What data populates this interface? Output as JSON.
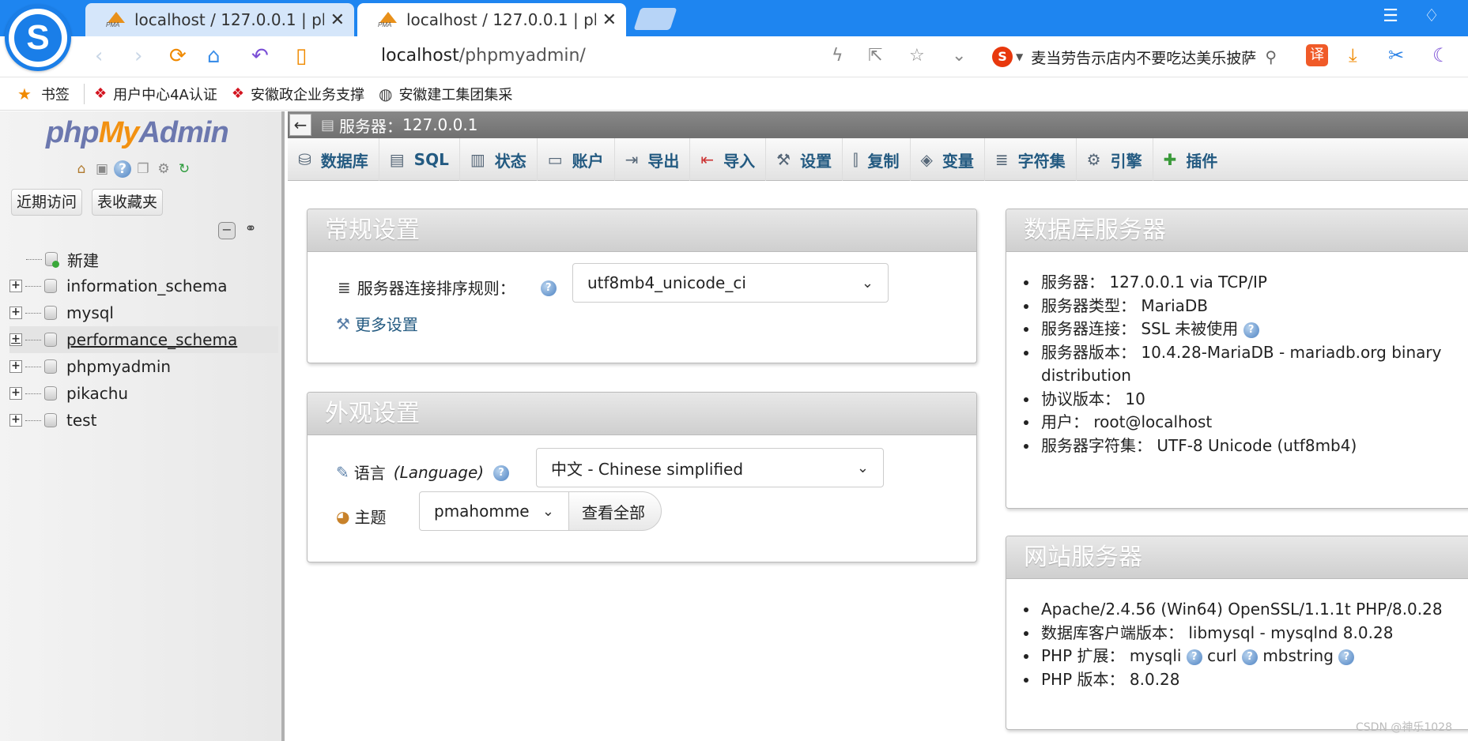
{
  "browser": {
    "tabs": [
      {
        "title": "localhost / 127.0.0.1 | phpMyAdmin",
        "close": "✕"
      },
      {
        "title": "localhost / 127.0.0.1 | phpMyAdmin",
        "close": "✕"
      }
    ],
    "url_host": "localhost",
    "url_path": "/phpmyadmin/",
    "search_text": "麦当劳告示店内不要吃达美乐披萨",
    "search_engine_letter": "S",
    "translate_label": "译",
    "bookmarks": [
      {
        "label": "书签",
        "icon": "star-icon"
      },
      {
        "label": "用户中心4A认证",
        "icon": "knot-icon"
      },
      {
        "label": "安徽政企业务支撑",
        "icon": "knot-icon"
      },
      {
        "label": "安徽建工集团集采",
        "icon": "globe-icon"
      }
    ]
  },
  "nav": {
    "logo": {
      "php": "php",
      "my": "My",
      "admin": "Admin"
    },
    "recent_btn": "近期访问",
    "favorites_btn": "表收藏夹",
    "new_label": "新建",
    "databases": [
      {
        "name": "information_schema"
      },
      {
        "name": "mysql"
      },
      {
        "name": "performance_schema"
      },
      {
        "name": "phpmyadmin"
      },
      {
        "name": "pikachu"
      },
      {
        "name": "test"
      }
    ]
  },
  "server_bar": {
    "label": "服务器：",
    "server": "127.0.0.1"
  },
  "menu": [
    {
      "label": "数据库",
      "icon": "database-icon"
    },
    {
      "label": "SQL",
      "icon": "sql-icon"
    },
    {
      "label": "状态",
      "icon": "status-icon"
    },
    {
      "label": "账户",
      "icon": "accounts-icon"
    },
    {
      "label": "导出",
      "icon": "export-icon"
    },
    {
      "label": "导入",
      "icon": "import-icon"
    },
    {
      "label": "设置",
      "icon": "settings-icon"
    },
    {
      "label": "复制",
      "icon": "replication-icon"
    },
    {
      "label": "变量",
      "icon": "variables-icon"
    },
    {
      "label": "字符集",
      "icon": "charset-icon"
    },
    {
      "label": "引擎",
      "icon": "engines-icon"
    },
    {
      "label": "插件",
      "icon": "plugins-icon"
    }
  ],
  "general": {
    "title": "常规设置",
    "collation_label": "服务器连接排序规则：",
    "collation_value": "utf8mb4_unicode_ci",
    "more_settings": "更多设置"
  },
  "appearance": {
    "title": "外观设置",
    "language_label": "语言",
    "language_label_en": "(Language)",
    "language_value": "中文 - Chinese simplified",
    "theme_label": "主题",
    "theme_value": "pmahomme",
    "view_all": "查看全部"
  },
  "db_server": {
    "title": "数据库服务器",
    "items": [
      {
        "label": "服务器：",
        "value": "127.0.0.1 via TCP/IP"
      },
      {
        "label": "服务器类型：",
        "value": "MariaDB"
      },
      {
        "label": "服务器连接：",
        "value": "SSL 未被使用"
      },
      {
        "label": "服务器版本：",
        "value": "10.4.28-MariaDB - mariadb.org binary distribution"
      },
      {
        "label": "协议版本：",
        "value": "10"
      },
      {
        "label": "用户：",
        "value": "root@localhost"
      },
      {
        "label": "服务器字符集：",
        "value": "UTF-8 Unicode (utf8mb4)"
      }
    ]
  },
  "web_server": {
    "title": "网站服务器",
    "apache": "Apache/2.4.56 (Win64) OpenSSL/1.1.1t PHP/8.0.28",
    "client_label": "数据库客户端版本：",
    "client_value": "libmysql - mysqlnd 8.0.28",
    "ext_label": "PHP 扩展：",
    "ext_values": [
      "mysqli",
      "curl",
      "mbstring"
    ],
    "php_label": "PHP 版本：",
    "php_value": "8.0.28"
  },
  "watermark": "CSDN @神乐1028"
}
